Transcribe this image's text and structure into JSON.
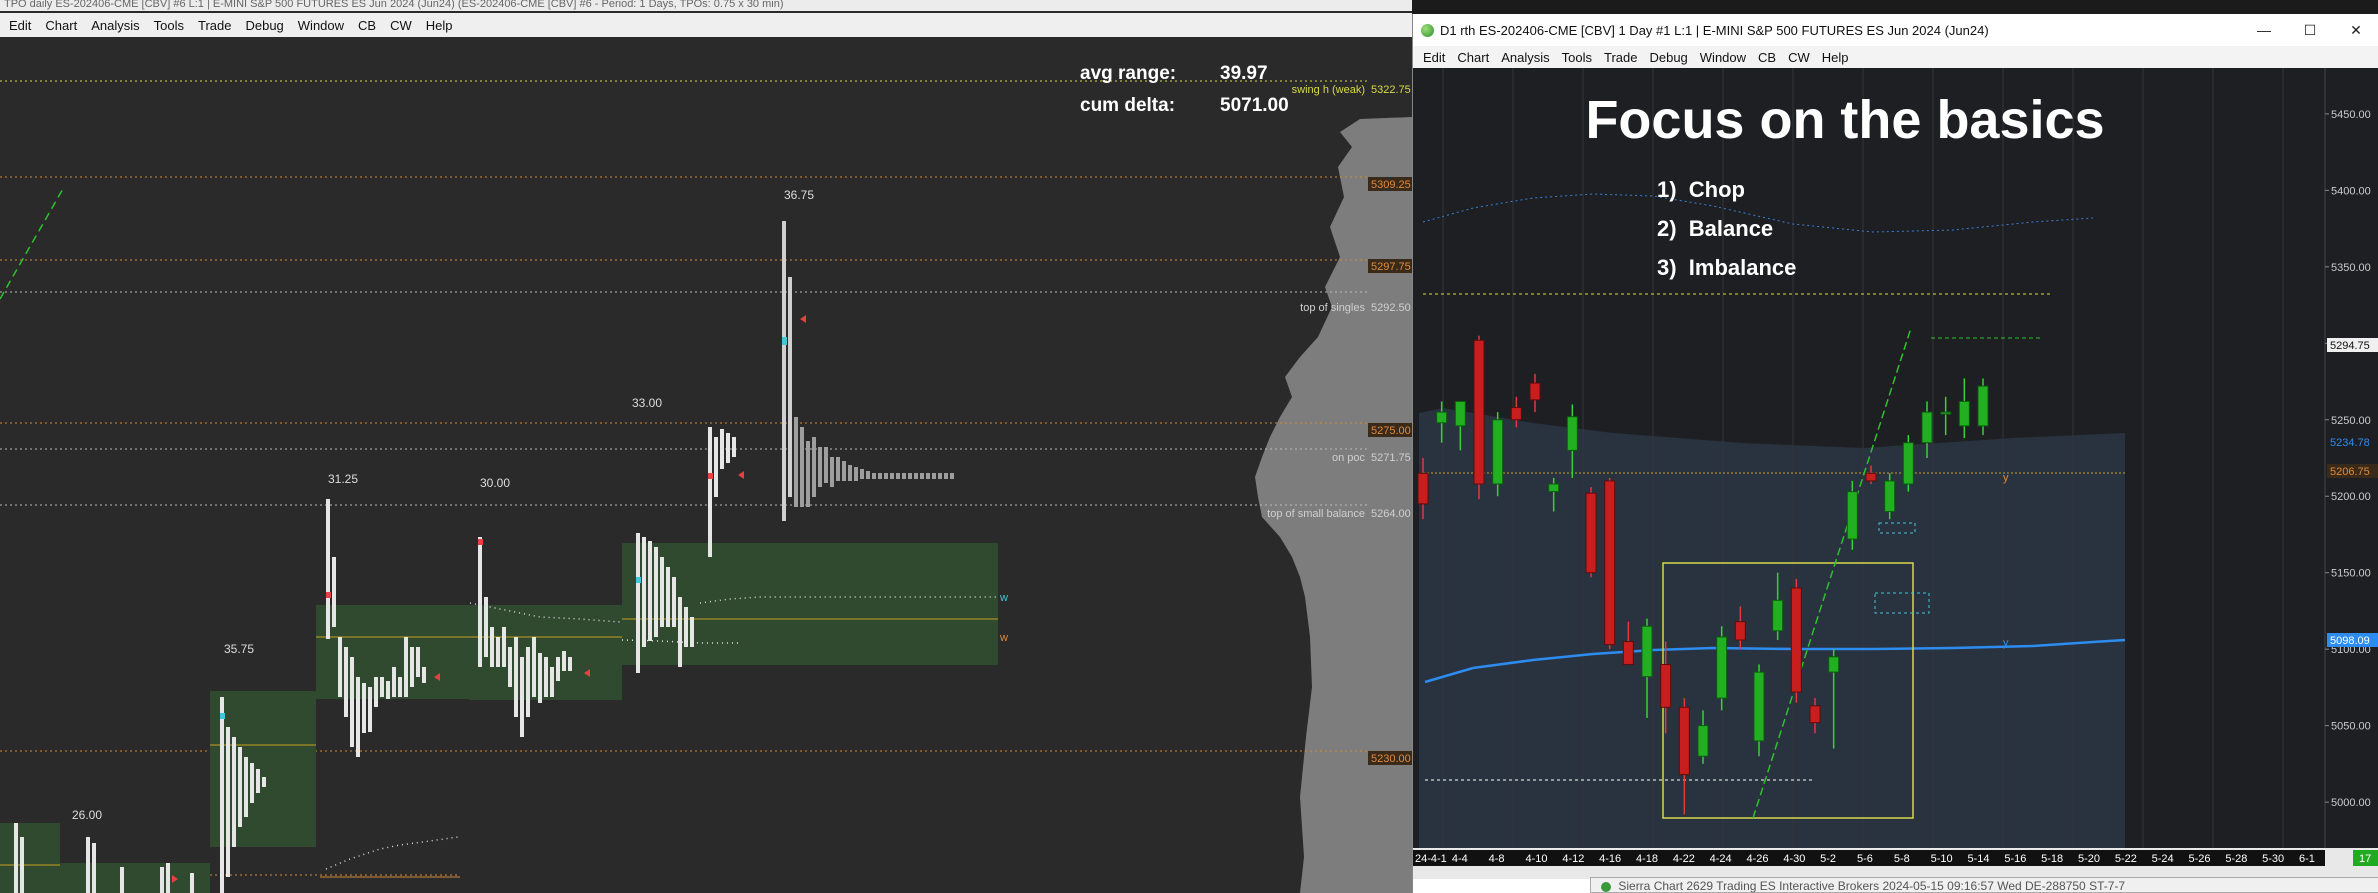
{
  "left_window": {
    "title": "TPO daily ES-202406-CME [CBV] #6 L:1 | E-MINI S&P 500 FUTURES ES Jun 2024 (Jun24) (ES-202406-CME [CBV] #6 - Period: 1 Days, TPOs: 0.75 x 30 min)",
    "menu": [
      "Edit",
      "Chart",
      "Analysis",
      "Tools",
      "Trade",
      "Debug",
      "Window",
      "CB",
      "CW",
      "Help"
    ],
    "stats": {
      "avg_range_label": "avg range:",
      "avg_range_value": "39.97",
      "cum_delta_label": "cum delta:",
      "cum_delta_value": "5071.00"
    },
    "day_ranges": [
      "26.00",
      "35.75",
      "31.25",
      "30.00",
      "33.00",
      "36.75"
    ],
    "level_labels": {
      "swing_high": "swing h (weak)",
      "top_of_singles": "top of singles",
      "on_poc": "on poc",
      "top_of_small_balance": "top of small balance"
    },
    "price_tags": [
      "5322.75",
      "5309.25",
      "5297.75",
      "5292.50",
      "5275.00",
      "5271.75",
      "5264.00",
      "5230.00"
    ],
    "w_markers": [
      "w",
      "w"
    ]
  },
  "right_window": {
    "title": "D1 rth ES-202406-CME [CBV]  1 Day  #1 L:1 | E-MINI S&P 500 FUTURES ES Jun 2024 (Jun24)",
    "menu": [
      "Edit",
      "Chart",
      "Analysis",
      "Tools",
      "Trade",
      "Debug",
      "Window",
      "CB",
      "CW",
      "Help"
    ],
    "controls": {
      "minimize": "—",
      "maximize": "☐",
      "close": "✕"
    },
    "headline": "Focus on the basics",
    "list": [
      "1)  Chop",
      "2)  Balance",
      "3)  Imbalance"
    ],
    "y_axis": [
      "5450.00",
      "5400.00",
      "5350.00",
      "5300.00",
      "5250.00",
      "5200.00",
      "5150.00",
      "5100.00",
      "5050.00",
      "5000.00"
    ],
    "price_tags": [
      "5294.75",
      "5234.78",
      "5206.75",
      "5098.09"
    ],
    "level_marks": [
      "y",
      "y"
    ],
    "x_axis": [
      "24-4-1",
      "4-4",
      "4-8",
      "4-10",
      "4-12",
      "4-16",
      "4-18",
      "4-22",
      "4-24",
      "4-26",
      "4-30",
      "5-2",
      "5-6",
      "5-8",
      "5-10",
      "5-14",
      "5-16",
      "5-18",
      "5-20",
      "5-22",
      "5-24",
      "5-26",
      "5-28",
      "5-30",
      "6-1"
    ],
    "corner_badge": "17"
  },
  "bottom_window": {
    "title": "Sierra Chart 2629 Trading ES Interactive Brokers 2024-05-15  09:16:57 Wed DE-288750  ST-7-7"
  },
  "chart_data": {
    "type": "candlestick",
    "title": "",
    "y_range": [
      4970,
      5480
    ],
    "candles": [
      {
        "o": 5215,
        "h": 5225,
        "l": 5185,
        "c": 5195
      },
      {
        "o": 5248,
        "h": 5262,
        "l": 5235,
        "c": 5255
      },
      {
        "o": 5246,
        "h": 5260,
        "l": 5230,
        "c": 5262
      },
      {
        "o": 5302,
        "h": 5305,
        "l": 5198,
        "c": 5208
      },
      {
        "o": 5208,
        "h": 5255,
        "l": 5200,
        "c": 5250
      },
      {
        "o": 5258,
        "h": 5265,
        "l": 5245,
        "c": 5250
      },
      {
        "o": 5274,
        "h": 5280,
        "l": 5255,
        "c": 5263
      },
      {
        "o": 5203,
        "h": 5212,
        "l": 5190,
        "c": 5208
      },
      {
        "o": 5230,
        "h": 5260,
        "l": 5212,
        "c": 5252
      },
      {
        "o": 5202,
        "h": 5206,
        "l": 5147,
        "c": 5150
      },
      {
        "o": 5210,
        "h": 5212,
        "l": 5100,
        "c": 5103
      },
      {
        "o": 5105,
        "h": 5118,
        "l": 5090,
        "c": 5090
      },
      {
        "o": 5082,
        "h": 5120,
        "l": 5055,
        "c": 5115
      },
      {
        "o": 5090,
        "h": 5105,
        "l": 5045,
        "c": 5062
      },
      {
        "o": 5062,
        "h": 5068,
        "l": 4992,
        "c": 5018
      },
      {
        "o": 5030,
        "h": 5060,
        "l": 5025,
        "c": 5050
      },
      {
        "o": 5068,
        "h": 5115,
        "l": 5060,
        "c": 5108
      },
      {
        "o": 5118,
        "h": 5128,
        "l": 5100,
        "c": 5106
      },
      {
        "o": 5040,
        "h": 5090,
        "l": 5030,
        "c": 5085
      },
      {
        "o": 5112,
        "h": 5150,
        "l": 5106,
        "c": 5132
      },
      {
        "o": 5140,
        "h": 5146,
        "l": 5065,
        "c": 5072
      },
      {
        "o": 5063,
        "h": 5068,
        "l": 5045,
        "c": 5052
      },
      {
        "o": 5085,
        "h": 5100,
        "l": 5035,
        "c": 5095
      },
      {
        "o": 5172,
        "h": 5210,
        "l": 5165,
        "c": 5203
      },
      {
        "o": 5215,
        "h": 5220,
        "l": 5208,
        "c": 5210
      },
      {
        "o": 5190,
        "h": 5215,
        "l": 5185,
        "c": 5210
      },
      {
        "o": 5208,
        "h": 5240,
        "l": 5203,
        "c": 5235
      },
      {
        "o": 5235,
        "h": 5262,
        "l": 5225,
        "c": 5255
      },
      {
        "o": 5255,
        "h": 5265,
        "l": 5240,
        "c": 5255
      },
      {
        "o": 5246,
        "h": 5277,
        "l": 5238,
        "c": 5262
      },
      {
        "o": 5246,
        "h": 5277,
        "l": 5240,
        "c": 5272
      }
    ]
  }
}
